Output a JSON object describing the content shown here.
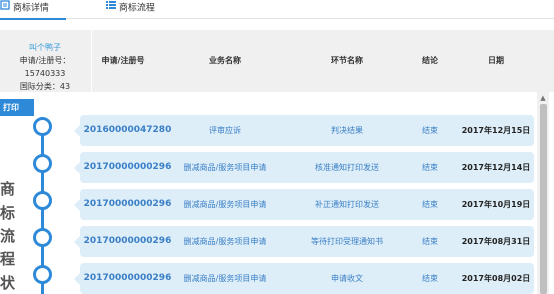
{
  "tabs": [
    {
      "label": "商标详情"
    },
    {
      "label": "商标流程"
    }
  ],
  "info": {
    "name": "叫个鸭子",
    "reg_number": "申请/注册号：15740333",
    "intl_class": "国际分类：43"
  },
  "columns": {
    "reg_no": "申请/注册号",
    "business": "业务名称",
    "step": "环节名称",
    "result": "结论",
    "date": "日期"
  },
  "print_label": "打印",
  "side_label": [
    "商",
    "标",
    "流",
    "程",
    "状"
  ],
  "rows": [
    {
      "num": "20160000047280",
      "business": "评审应诉",
      "step": "判决结果",
      "result": "结束",
      "date": "2017年12月15日"
    },
    {
      "num": "20170000000296",
      "business": "删减商品/服务项目申请",
      "step": "核准通知打印发送",
      "result": "结束",
      "date": "2017年12月14日"
    },
    {
      "num": "20170000000296",
      "business": "删减商品/服务项目申请",
      "step": "补正通知打印发送",
      "result": "结束",
      "date": "2017年10月19日"
    },
    {
      "num": "20170000000296",
      "business": "删减商品/服务项目申请",
      "step": "等待打印受理通知书",
      "result": "结束",
      "date": "2017年08月31日"
    },
    {
      "num": "20170000000296",
      "business": "删减商品/服务项目申请",
      "step": "申请收文",
      "result": "结束",
      "date": "2017年08月02日"
    }
  ],
  "colors": {
    "accent": "#2e8ad8",
    "row_bg": "#ddeef8",
    "link": "#3a7fc6"
  }
}
